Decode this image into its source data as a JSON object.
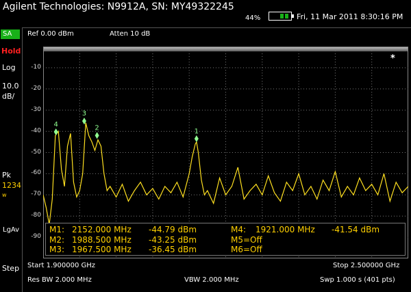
{
  "header": {
    "title": "Agilent Technologies: N9912A, SN: MY49322245",
    "battery_percent": "44%",
    "datetime": "Fri, 11 Mar 2011 8:30:16 PM"
  },
  "sidebar": {
    "mode": "SA",
    "hold": "Hold",
    "scale_type": "Log",
    "scale_value": "10.0\ndB/",
    "detector": "Pk",
    "trace_numbers": "1234",
    "trace_state": "w",
    "averaging": "LgAv",
    "step": "Step"
  },
  "topbar": {
    "reference": "Ref 0.00 dBm",
    "attenuation": "Atten 10 dB"
  },
  "plot": {
    "y_ticks": [
      "-10",
      "-20",
      "-30",
      "-40",
      "-50",
      "-60",
      "-70",
      "-80",
      "-90"
    ],
    "asterisk": "*",
    "trace_color": "#ffe020",
    "marker_color": "#90ff90"
  },
  "markers": [
    {
      "label": "M1:",
      "freq": "2152.000 MHz",
      "level": "-44.79 dBm"
    },
    {
      "label": "M2:",
      "freq": "1988.500 MHz",
      "level": "-43.25 dBm"
    },
    {
      "label": "M3:",
      "freq": "1967.500 MHz",
      "level": "-36.45 dBm"
    },
    {
      "label": "M4:",
      "freq": "1921.000 MHz",
      "level": "-41.54 dBm"
    },
    {
      "label": "M5=Off"
    },
    {
      "label": "M6=Off"
    }
  ],
  "marker_flags": [
    "1",
    "2",
    "3",
    "4"
  ],
  "footer": {
    "start": "Start 1.900000 GHz",
    "stop": "Stop 2.500000 GHz",
    "rbw": "Res BW 2.000 MHz",
    "vbw": "VBW 2.000 MHz",
    "sweep": "Swp 1.000  s (401 pts)"
  },
  "chart_data": {
    "type": "line",
    "x_range": [
      1900,
      2500
    ],
    "y_range": [
      0,
      -100
    ],
    "xlabel": "",
    "ylabel": "",
    "series": [
      {
        "x": [
          1900,
          1905,
          1910,
          1915,
          1920,
          1925,
          1930,
          1935,
          1940,
          1945,
          1950,
          1955,
          1960,
          1965,
          1970,
          1975,
          1980,
          1985,
          1990,
          1995,
          2000,
          2005,
          2010,
          2020,
          2030,
          2040,
          2050,
          2060,
          2070,
          2080,
          2090,
          2100,
          2110,
          2120,
          2130,
          2140,
          2145,
          2150,
          2152,
          2155,
          2160,
          2165,
          2170,
          2180,
          2190,
          2200,
          2210,
          2220,
          2230,
          2240,
          2250,
          2260,
          2270,
          2280,
          2290,
          2300,
          2310,
          2320,
          2330,
          2340,
          2350,
          2360,
          2370,
          2380,
          2390,
          2400,
          2410,
          2420,
          2430,
          2440,
          2450,
          2460,
          2470,
          2480,
          2490,
          2500
        ],
        "y": [
          -70,
          -76,
          -84,
          -72,
          -42,
          -40,
          -58,
          -66,
          -47,
          -41,
          -64,
          -71,
          -68,
          -60,
          -36,
          -42,
          -45,
          -49,
          -44,
          -47,
          -60,
          -68,
          -66,
          -71,
          -65,
          -73,
          -68,
          -64,
          -70,
          -67,
          -72,
          -66,
          -69,
          -64,
          -71,
          -60,
          -52,
          -46,
          -45,
          -50,
          -63,
          -70,
          -68,
          -74,
          -62,
          -70,
          -66,
          -57,
          -72,
          -68,
          -65,
          -70,
          -61,
          -69,
          -73,
          -64,
          -68,
          -60,
          -70,
          -66,
          -72,
          -63,
          -68,
          -59,
          -71,
          -66,
          -70,
          -62,
          -68,
          -65,
          -70,
          -60,
          -73,
          -64,
          -69,
          -66
        ]
      }
    ],
    "markers": [
      {
        "id": "1",
        "x": 2152.0,
        "y": -44.79
      },
      {
        "id": "2",
        "x": 1988.5,
        "y": -43.25
      },
      {
        "id": "3",
        "x": 1967.5,
        "y": -36.45
      },
      {
        "id": "4",
        "x": 1921.0,
        "y": -41.54
      }
    ],
    "grid": true
  }
}
